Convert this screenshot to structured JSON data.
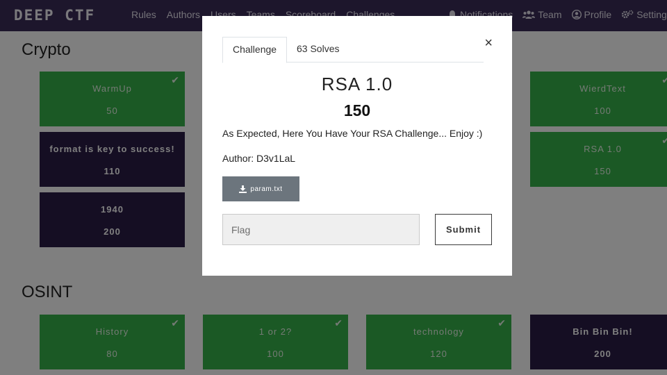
{
  "navbar": {
    "brand": "DEEP CTF",
    "links": [
      "Rules",
      "Authors",
      "Users",
      "Teams",
      "Scoreboard",
      "Challenges"
    ],
    "right": [
      {
        "icon": "bell-icon",
        "label": "Notifications"
      },
      {
        "icon": "users-icon",
        "label": "Team"
      },
      {
        "icon": "user-circle-icon",
        "label": "Profile"
      },
      {
        "icon": "cogs-icon",
        "label": "Settings"
      }
    ]
  },
  "categories": [
    {
      "title": "Crypto",
      "cards": [
        {
          "name": "WarmUp",
          "value": "50",
          "solved": true
        },
        {
          "name": "WierdText",
          "value": "100",
          "solved": true
        },
        {
          "name": "format is key to success!",
          "value": "110",
          "solved": false
        },
        {
          "name": "RSA 1.0",
          "value": "150",
          "solved": true
        },
        {
          "name": "1940",
          "value": "200",
          "solved": false
        }
      ]
    },
    {
      "title": "OSINT",
      "cards": [
        {
          "name": "History",
          "value": "80",
          "solved": true
        },
        {
          "name": "1 or 2?",
          "value": "100",
          "solved": true
        },
        {
          "name": "technology",
          "value": "120",
          "solved": true
        },
        {
          "name": "Bin Bin Bin!",
          "value": "200",
          "solved": false
        }
      ]
    }
  ],
  "modal": {
    "tabs": [
      "Challenge",
      "63 Solves"
    ],
    "title": "RSA 1.0",
    "value": "150",
    "description": "As Expected, Here You Have Your RSA Challenge... Enjoy :)",
    "author": "Author: D3v1LaL",
    "file": "param.txt",
    "flag_placeholder": "Flag",
    "flag_value": "",
    "submit_label": "Submit",
    "close_symbol": "×"
  },
  "colors": {
    "navbar": "#3a2c58",
    "solved": "#37b24a",
    "unsolved": "#2b1d47",
    "file_button": "#6c757d"
  }
}
